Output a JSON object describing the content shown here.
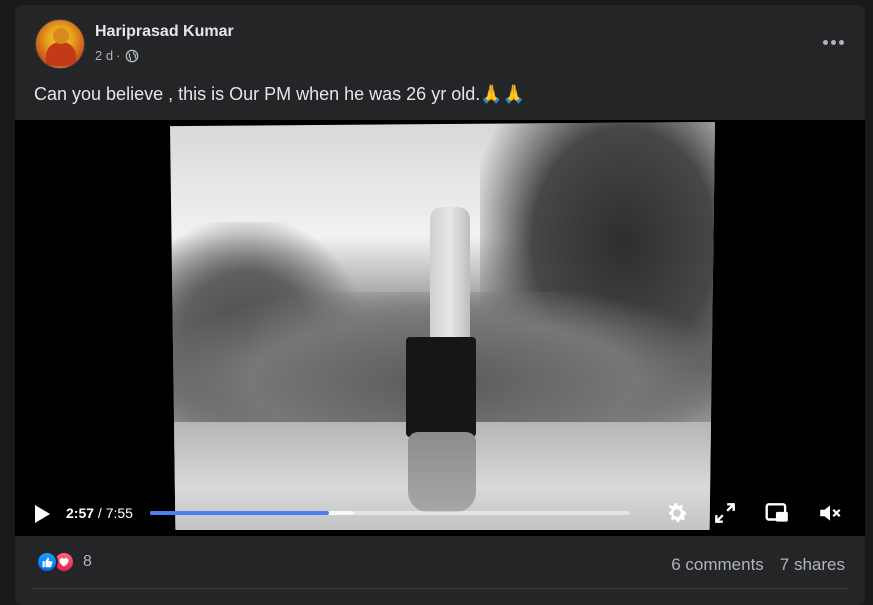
{
  "post": {
    "author": "Hariprasad Kumar",
    "time": "2 d",
    "dot": "·",
    "privacy_icon": "globe-icon",
    "text": "Can you believe , this is Our PM when he was 26 yr old.🙏🙏",
    "menu_icon": "more-horizontal-icon"
  },
  "video": {
    "current_time": "2:57",
    "separator": " / ",
    "total_time": "7:55",
    "progress": 0.373,
    "buffered": 0.425,
    "progress_color": "#4a7ef5",
    "controls": [
      "play-icon",
      "settings-icon",
      "fullscreen-icon",
      "picture-in-picture-icon",
      "muted-volume-icon"
    ]
  },
  "footer": {
    "reactions": [
      "like-icon",
      "love-icon"
    ],
    "reaction_count": "8",
    "comments": "6 comments",
    "shares": "7 shares"
  }
}
